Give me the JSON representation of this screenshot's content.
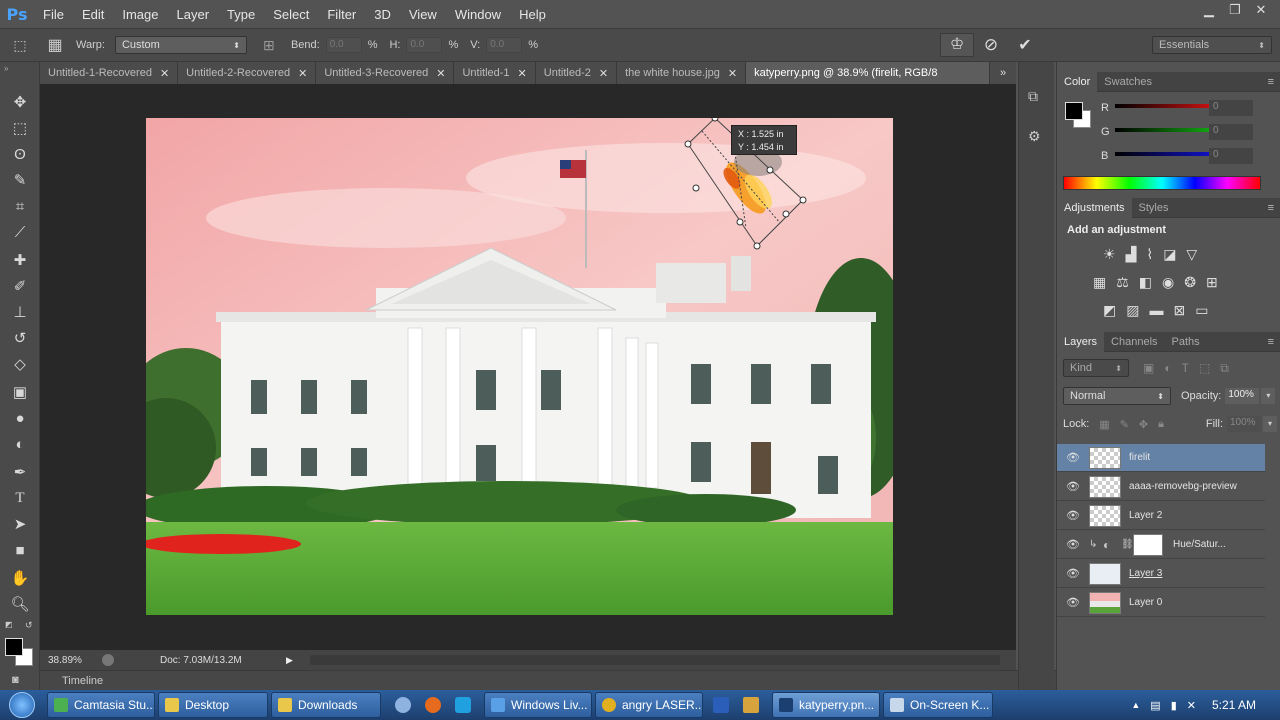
{
  "app": {
    "logo": "Ps"
  },
  "menu": [
    "File",
    "Edit",
    "Image",
    "Layer",
    "Type",
    "Select",
    "Filter",
    "3D",
    "View",
    "Window",
    "Help"
  ],
  "window_controls": {
    "minimize": "▁",
    "restore": "❐",
    "close": "✕"
  },
  "options": {
    "warp_label": "Warp:",
    "warp_value": "Custom",
    "bend_label": "Bend:",
    "bend_value": "0.0",
    "h_label": "H:",
    "h_value": "0.0",
    "v_label": "V:",
    "v_value": "0.0",
    "percent": "%",
    "workspace": "Essentials"
  },
  "tabs": [
    {
      "label": "Untitled-1-Recovered",
      "close": "✕"
    },
    {
      "label": "Untitled-2-Recovered",
      "close": "✕"
    },
    {
      "label": "Untitled-3-Recovered",
      "close": "✕"
    },
    {
      "label": "Untitled-1",
      "close": "✕"
    },
    {
      "label": "Untitled-2",
      "close": "✕"
    },
    {
      "label": "the white house.jpg",
      "close": "✕"
    },
    {
      "label": "katyperry.png @ 38.9% (firelit, RGB/8",
      "close": ""
    }
  ],
  "tabs_overflow": "»",
  "transform_tooltip": {
    "x": "X :  1.525 in",
    "y": "Y :  1.454 in"
  },
  "status": {
    "zoom": "38.89%",
    "doc": "Doc: 7.03M/13.2M"
  },
  "timeline": {
    "label": "Timeline"
  },
  "color_panel": {
    "tabs": [
      "Color",
      "Swatches"
    ],
    "channels": [
      {
        "name": "R",
        "value": "0",
        "color": "#cc1111"
      },
      {
        "name": "G",
        "value": "0",
        "color": "#11aa11"
      },
      {
        "name": "B",
        "value": "0",
        "color": "#1111cc"
      }
    ]
  },
  "adjustments_panel": {
    "tabs": [
      "Adjustments",
      "Styles"
    ],
    "title": "Add an adjustment"
  },
  "layers_panel": {
    "tabs": [
      "Layers",
      "Channels",
      "Paths"
    ],
    "kind": "Kind",
    "blend_mode": "Normal",
    "opacity_label": "Opacity:",
    "opacity_value": "100%",
    "lock_label": "Lock:",
    "fill_label": "Fill:",
    "fill_value": "100%",
    "layers": [
      {
        "name": "firelit",
        "selected": true
      },
      {
        "name": "aaaa-removebg-preview",
        "selected": false
      },
      {
        "name": "Layer 2",
        "selected": false
      },
      {
        "name": "Hue/Satur...",
        "selected": false
      },
      {
        "name": "Layer 3",
        "selected": false
      },
      {
        "name": "Layer 0",
        "selected": false
      }
    ]
  },
  "taskbar": {
    "items": [
      "Camtasia Stu...",
      "Desktop",
      "Downloads",
      "Windows Liv...",
      "angry LASER...",
      "katyperry.pn...",
      "On-Screen K..."
    ],
    "clock": "5:21 AM"
  },
  "colors": {
    "accent": "#4aa3ff",
    "selected_layer": "#6382a6",
    "sky": "#f3a9a9",
    "grass": "#5aa33a"
  }
}
